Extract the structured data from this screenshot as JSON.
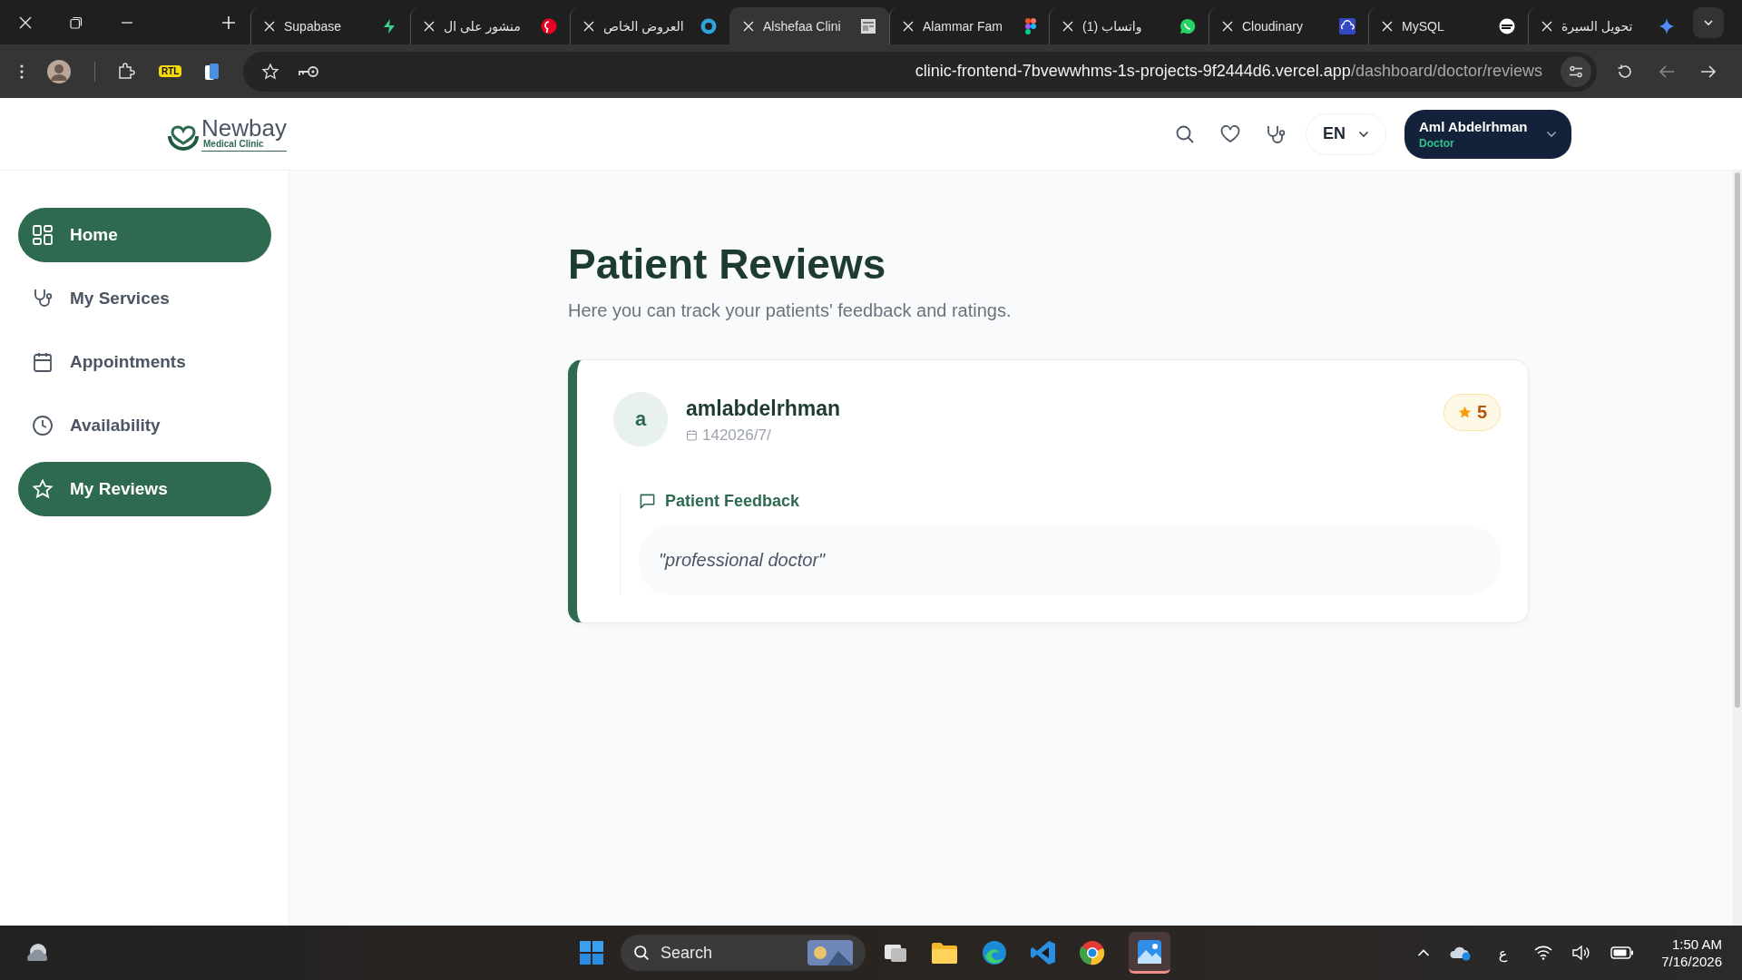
{
  "browser": {
    "tabs": [
      {
        "title": "Supabase",
        "kind": "bolt",
        "selected": false
      },
      {
        "title": "منشور على ال",
        "kind": "pin",
        "selected": false
      },
      {
        "title": "العروض الخاص",
        "kind": "ring",
        "selected": false
      },
      {
        "title": "Alshefaa Clini",
        "kind": "page",
        "selected": true
      },
      {
        "title": "Alammar Fam",
        "kind": "figma",
        "selected": false
      },
      {
        "title": "(1) واتساب",
        "kind": "chat",
        "selected": false
      },
      {
        "title": "Cloudinary",
        "kind": "cloud",
        "selected": false
      },
      {
        "title": "MySQL",
        "kind": "disc",
        "selected": false
      },
      {
        "title": "تحويل السيرة",
        "kind": "sparkle",
        "selected": false
      }
    ],
    "extension_badge": "RTL",
    "url": {
      "host": "clinic-frontend-7bvewwhms-1s-projects-9f2444d6.vercel.app",
      "path": "/dashboard/doctor/reviews"
    }
  },
  "header": {
    "logo": {
      "name": "Newbay",
      "tagline": "Medical Clinic"
    },
    "language": "EN",
    "user": {
      "name": "Aml Abdelrhman",
      "role": "Doctor"
    }
  },
  "sidebar": {
    "items": [
      {
        "label": "Home",
        "kind": "grid",
        "selected": true
      },
      {
        "label": "My Services",
        "kind": "stethoscope",
        "selected": false
      },
      {
        "label": "Appointments",
        "kind": "calendar",
        "selected": false
      },
      {
        "label": "Availability",
        "kind": "clock",
        "selected": false
      },
      {
        "label": "My Reviews",
        "kind": "star",
        "selected": true
      }
    ]
  },
  "page": {
    "title": "Patient Reviews",
    "subtitle": "Here you can track your patients' feedback and ratings."
  },
  "reviews": [
    {
      "initial": "a",
      "name": "amlabdelrhman",
      "date": "142026/7/",
      "rating": "5",
      "feedback_label": "Patient Feedback",
      "comment": "\"professional doctor\""
    }
  ],
  "taskbar": {
    "search_label": "Search",
    "keyboard": "ع",
    "time": "1:50 AM",
    "date": "7/16/2026"
  }
}
